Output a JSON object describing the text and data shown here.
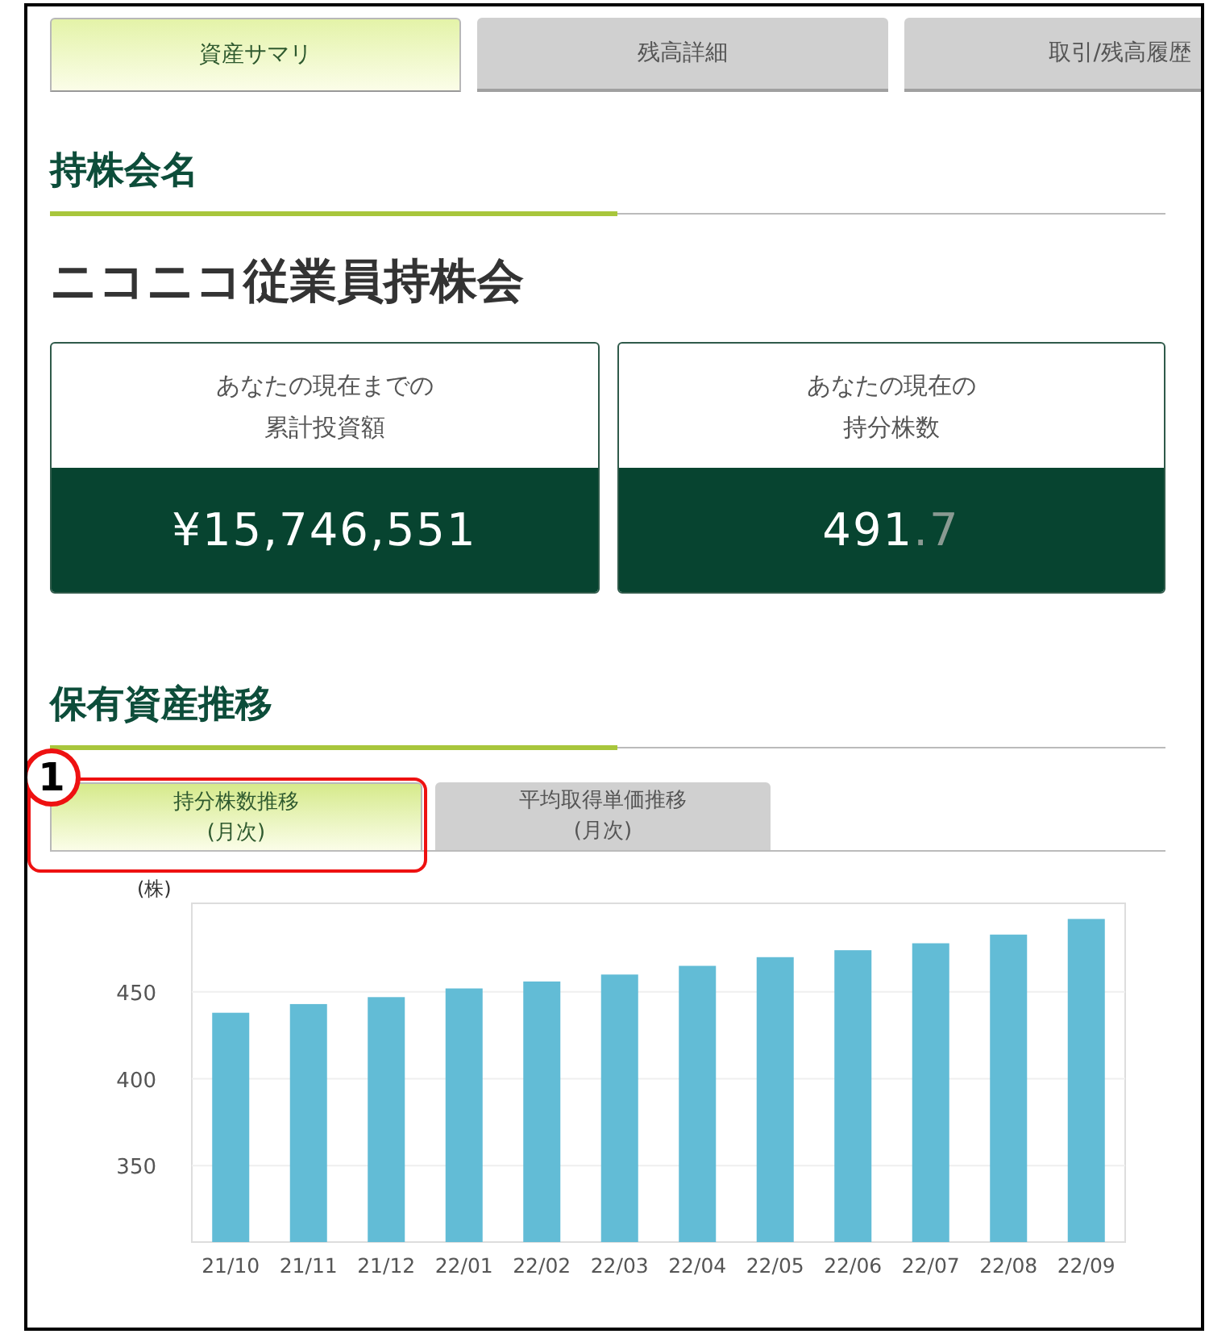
{
  "tabs": [
    {
      "label": "資産サマリ",
      "selected": true
    },
    {
      "label": "残高詳細",
      "selected": false
    },
    {
      "label": "取引/残高履歴",
      "selected": false
    }
  ],
  "section_1": {
    "heading": "持株会名",
    "company_name": "ニコニコ従業員持株会"
  },
  "cards": [
    {
      "label_line_1": "あなたの現在までの",
      "label_line_2": "累計投資額",
      "value": "¥15,746,551"
    },
    {
      "label_line_1": "あなたの現在の",
      "label_line_2": "持分株数",
      "value": "491",
      "decimal": ".7"
    }
  ],
  "section_2": {
    "heading": "保有資産推移",
    "subtabs": [
      {
        "line_1": "持分株数推移",
        "line_2": "(月次)",
        "selected": true
      },
      {
        "line_1": "平均取得単価推移",
        "line_2": "(月次)",
        "selected": false
      }
    ],
    "annotation": {
      "number": "1"
    },
    "chart_data": {
      "type": "bar",
      "ylabel": "(株)",
      "categories": [
        "21/10",
        "21/11",
        "21/12",
        "22/01",
        "22/02",
        "22/03",
        "22/04",
        "22/05",
        "22/06",
        "22/07",
        "22/08",
        "22/09"
      ],
      "grid": true,
      "series": [
        {
          "color": "#62bcd6",
          "values": [
            438,
            443,
            447,
            452,
            456,
            460,
            465,
            470,
            474,
            478,
            483,
            492
          ]
        }
      ],
      "ylim": [
        306,
        501
      ],
      "yticks": [
        350,
        400,
        450
      ]
    }
  }
}
